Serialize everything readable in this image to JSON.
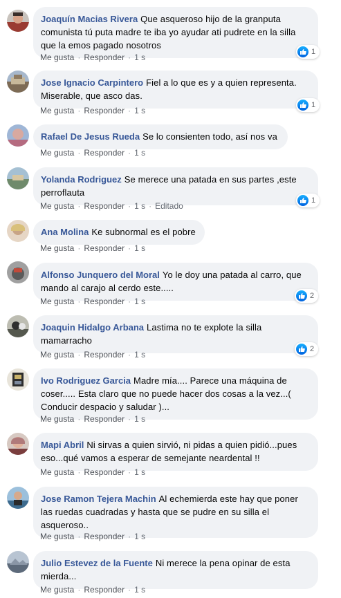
{
  "actions": {
    "like": "Me gusta",
    "reply": "Responder",
    "edited": "Editado"
  },
  "colors": {
    "author": "#385898",
    "bubble": "#f0f2f5",
    "like_blue": "#1877f2",
    "meta": "#616770"
  },
  "comments": [
    {
      "author": "Joaquín Macias Rivera",
      "text": "Que asqueroso hijo de la granputa comunista tú puta madre te iba yo ayudar ati pudrete en la silla que la emos pagado nosotros",
      "time": "1 s",
      "reactions": "1",
      "avatar_color": "#9a3b32"
    },
    {
      "author": "Jose Ignacio Carpintero",
      "text": "Fiel a lo que es y a quien representa. Miserable, que asco das.",
      "time": "1 s",
      "reactions": "1",
      "avatar_color": "#6b7f9a"
    },
    {
      "author": "Rafael De Jesus Rueda",
      "text": "Se lo consienten todo, así nos va",
      "time": "1 s",
      "avatar_color": "#b56b80"
    },
    {
      "author": "Yolanda Rodriguez",
      "text": "Se merece una patada en sus partes ,este perroflauta",
      "time": "1 s",
      "edited": true,
      "reactions": "1",
      "avatar_color": "#7a8f86"
    },
    {
      "author": "Ana Molina",
      "text": "Ke subnormal es el pobre",
      "time": "1 s",
      "avatar_color": "#c8a486"
    },
    {
      "author": "Alfonso Junquero del Moral",
      "text": "Yo le doy una patada al carro, que mando al carajo al cerdo este.....",
      "time": "1 s",
      "reactions": "2",
      "avatar_color": "#6e6e6e"
    },
    {
      "author": "Joaquin Hidalgo Arbana",
      "text": "Lastima no te explote la silla mamarracho",
      "time": "1 s",
      "reactions": "2",
      "avatar_color": "#8a8d82"
    },
    {
      "author": "Ivo Rodriguez Garcia",
      "text": "Madre mía.... Parece una máquina de coser..... Esta claro que no puede hacer dos cosas a la vez...( Conducir despacio y saludar )...",
      "time": "1 s",
      "avatar_color": "#2d2d2d"
    },
    {
      "author": "Mapi Abril",
      "text": "Ni sirvas a quien sirvió, ni pidas a quien pidió...pues eso...qué vamos a esperar de semejante neardental !!",
      "time": "1 s",
      "avatar_color": "#b07a7a"
    },
    {
      "author": "Jose Ramon Tejera Machin",
      "text": "Al echemierda este hay que poner las ruedas cuadradas y hasta que se pudre en su silla el asqueroso..",
      "time": "1 s",
      "avatar_color": "#5f86a8"
    },
    {
      "author": "Julio Estevez de la Fuente",
      "text": "Ni merece la pena opinar de esta mierda...",
      "time": "1 s",
      "avatar_color": "#6d7a8c"
    }
  ]
}
